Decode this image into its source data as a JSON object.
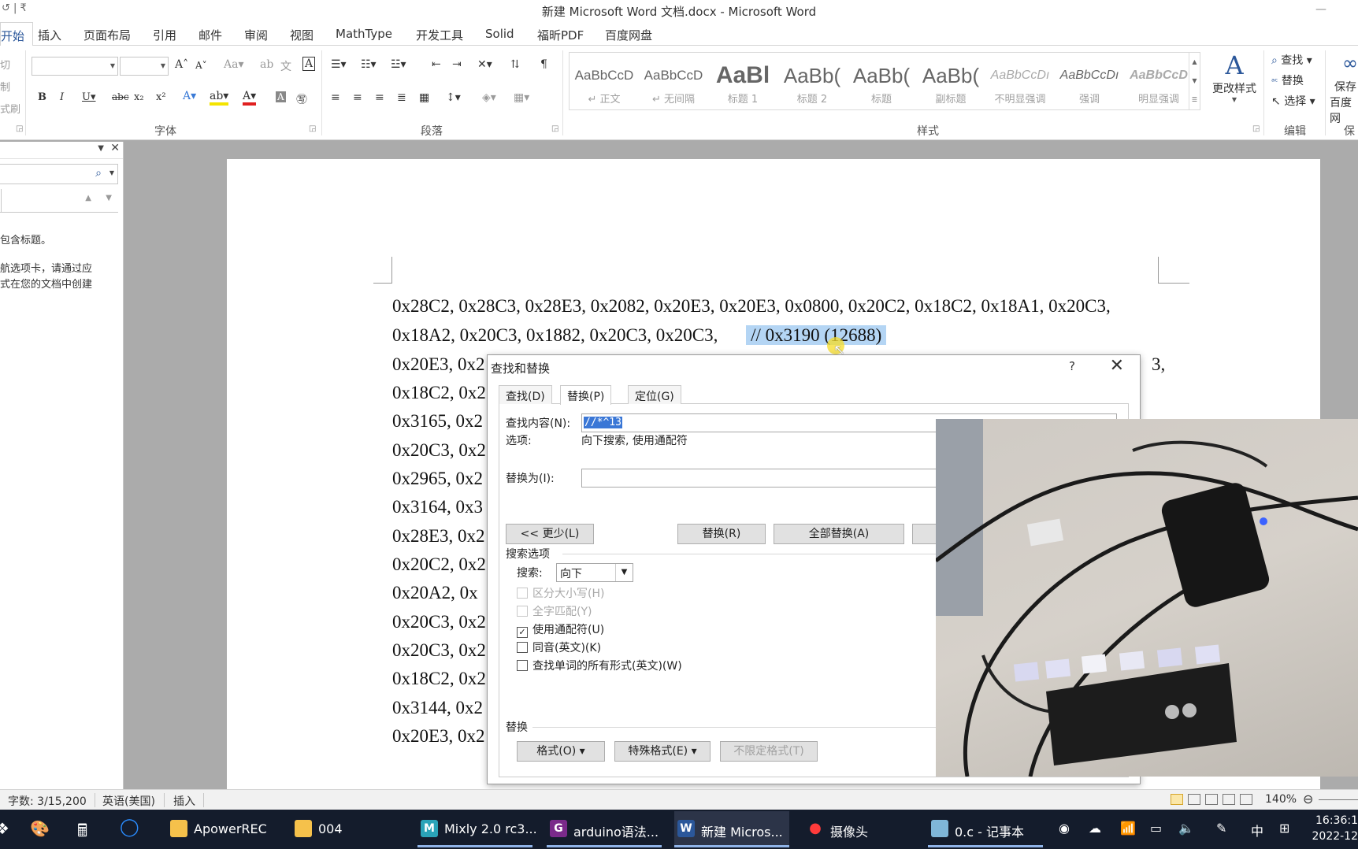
{
  "window": {
    "title": "新建 Microsoft Word 文档.docx - Microsoft Word",
    "quick_access": "↺ | ₹"
  },
  "ribbon_tabs": [
    "开始",
    "插入",
    "页面布局",
    "引用",
    "邮件",
    "审阅",
    "视图",
    "MathType",
    "开发工具",
    "Solid",
    "福昕PDF",
    "百度网盘"
  ],
  "ribbon": {
    "clipboard_labels": [
      "切",
      "制",
      "式刷"
    ],
    "groups": {
      "font": "字体",
      "paragraph": "段落",
      "styles": "样式",
      "editing": "编辑",
      "save_partial": "保"
    },
    "styles": [
      {
        "sample": "AaBbCcD",
        "name": "↵ 正文"
      },
      {
        "sample": "AaBbCcD",
        "name": "↵ 无间隔"
      },
      {
        "sample": "AaBl",
        "name": "标题 1"
      },
      {
        "sample": "AaBb(",
        "name": "标题 2"
      },
      {
        "sample": "AaBb(",
        "name": "标题"
      },
      {
        "sample": "AaBb(",
        "name": "副标题"
      },
      {
        "sample": "AaBbCcDı",
        "name": "不明显强调"
      },
      {
        "sample": "AaBbCcDı",
        "name": "强调"
      },
      {
        "sample": "AaBbCcD",
        "name": "明显强调"
      }
    ],
    "change_styles": "更改样式",
    "editing": {
      "find": "查找",
      "replace": "替换",
      "select": "选择"
    },
    "right_partial": [
      "保存",
      "百度网"
    ]
  },
  "nav_pane": {
    "messages": [
      "包含标题。",
      "航选项卡，请通过应",
      "式在您的文档中创建"
    ]
  },
  "document": {
    "lines": [
      "0x28C2, 0x28C3, 0x28E3, 0x2082, 0x20E3, 0x20E3, 0x0800, 0x20C2, 0x18C2, 0x18A1, 0x20C3,",
      "0x18A2, 0x20C3, 0x1882, 0x20C3, 0x20C3,",
      "0x20E3, 0x2",
      "0x18C2, 0x2",
      "0x3165, 0x2",
      "0x20C3, 0x2",
      "0x2965, 0x2",
      "0x3164, 0x3",
      "0x28E3, 0x2",
      "0x20C2, 0x2",
      "0x20A2,   0x",
      "0x20C3, 0x2",
      "0x20C3, 0x2",
      "0x18C2, 0x2",
      "0x3144, 0x2",
      "0x20E3, 0x2"
    ],
    "selected_comment": "// 0x3190 (12688)",
    "line3_tail": "3,"
  },
  "find_replace": {
    "title": "查找和替换",
    "help": "?",
    "close": "✕",
    "tabs": [
      "查找(D)",
      "替换(P)",
      "定位(G)"
    ],
    "find_label": "查找内容(N):",
    "find_value": "//*^13",
    "options_label": "选项:",
    "options_value": "向下搜索, 使用通配符",
    "replace_label": "替换为(I):",
    "replace_value": "",
    "buttons": {
      "less": "<< 更少(L)",
      "replace": "替换(R)",
      "replace_all": "全部替换(A)"
    },
    "search_options_title": "搜索选项",
    "search_label": "搜索:",
    "search_value": "向下",
    "checkboxes": [
      {
        "label": "区分大小写(H)",
        "checked": false,
        "enabled": false
      },
      {
        "label": "全字匹配(Y)",
        "checked": false,
        "enabled": false
      },
      {
        "label": "使用通配符(U)",
        "checked": true,
        "enabled": true
      },
      {
        "label": "同音(英文)(K)",
        "checked": false,
        "enabled": true
      },
      {
        "label": "查找单词的所有形式(英文)(W)",
        "checked": false,
        "enabled": true
      }
    ],
    "replace_section_title": "替换",
    "format_buttons": {
      "format": "格式(O) ▾",
      "special": "特殊格式(E) ▾",
      "no_format": "不限定格式(T)"
    }
  },
  "status_bar": {
    "word_count": "字数: 3/15,200",
    "language": "英语(美国)",
    "mode": "插入",
    "zoom": "140%"
  },
  "taskbar": {
    "items": [
      {
        "label": "ApowerREC",
        "icon": "folder-icon"
      },
      {
        "label": "004",
        "icon": "folder-icon"
      },
      {
        "label": "Mixly 2.0 rc3...",
        "icon": "mixly-icon"
      },
      {
        "label": "arduino语法...",
        "icon": "pdf-icon"
      },
      {
        "label": "新建 Micros...",
        "icon": "word-icon"
      },
      {
        "label": "摄像头",
        "icon": "record-icon"
      },
      {
        "label": "0.c - 记事本",
        "icon": "notepad-icon"
      }
    ],
    "ime": "中",
    "time": "16:36:1",
    "date": "2022-12"
  },
  "colors": {
    "word_blue": "#2b579a",
    "selection": "#b4d5f4",
    "taskbar": "#141c2c"
  }
}
